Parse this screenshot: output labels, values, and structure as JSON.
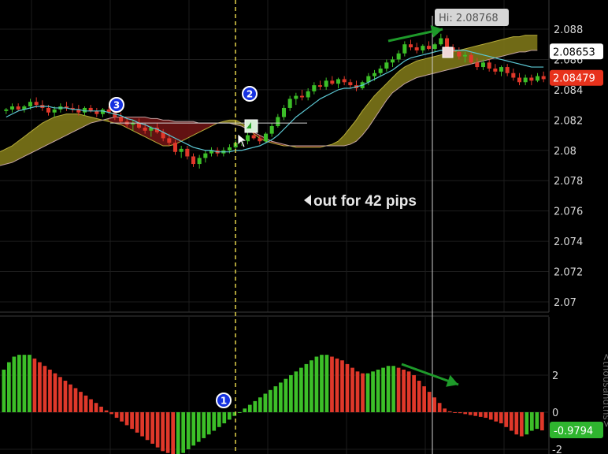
{
  "chart_data": [
    {
      "type": "candlestick",
      "title": "",
      "ylim": [
        2.069,
        2.09
      ],
      "y_ticks": [
        "2.088",
        "2.086",
        "2.084",
        "2.082",
        "2.08",
        "2.078",
        "2.076",
        "2.074",
        "2.072",
        "2.07"
      ],
      "y_tick_values": [
        2.088,
        2.086,
        2.084,
        2.082,
        2.08,
        2.078,
        2.076,
        2.074,
        2.072,
        2.07
      ],
      "price_labels": [
        {
          "text": "2.08653",
          "value": 2.08653,
          "bg": "#ffffff",
          "color": "#000000"
        },
        {
          "text": "2.08479",
          "value": 2.08479,
          "bg": "#e8321c",
          "color": "#ffffff"
        }
      ],
      "high_label": {
        "text": "Hi: 2.08768",
        "value": 2.08768
      },
      "annotation": "out for 42 pips",
      "markers": [
        {
          "label": "3",
          "value": 2.0832
        },
        {
          "label": "2",
          "value": 2.0843
        }
      ],
      "candles": [
        [
          2.0826,
          2.0828,
          2.0824,
          2.0827
        ],
        [
          2.0827,
          2.0831,
          2.0825,
          2.0829
        ],
        [
          2.0829,
          2.0831,
          2.0826,
          2.0827
        ],
        [
          2.0827,
          2.083,
          2.0825,
          2.0829
        ],
        [
          2.0829,
          2.0834,
          2.0827,
          2.0832
        ],
        [
          2.0832,
          2.0835,
          2.0828,
          2.083
        ],
        [
          2.083,
          2.0833,
          2.0826,
          2.0828
        ],
        [
          2.0828,
          2.083,
          2.0823,
          2.0825
        ],
        [
          2.0825,
          2.0829,
          2.0822,
          2.0827
        ],
        [
          2.0827,
          2.0831,
          2.0825,
          2.0829
        ],
        [
          2.0829,
          2.0832,
          2.0826,
          2.0828
        ],
        [
          2.0828,
          2.0831,
          2.0825,
          2.0827
        ],
        [
          2.0827,
          2.083,
          2.0823,
          2.0825
        ],
        [
          2.0825,
          2.0829,
          2.0823,
          2.0828
        ],
        [
          2.0828,
          2.083,
          2.0825,
          2.0826
        ],
        [
          2.0826,
          2.0828,
          2.0822,
          2.0824
        ],
        [
          2.0824,
          2.0828,
          2.0822,
          2.0827
        ],
        [
          2.0827,
          2.0829,
          2.0824,
          2.0825
        ],
        [
          2.0825,
          2.0827,
          2.082,
          2.0822
        ],
        [
          2.0822,
          2.0825,
          2.0818,
          2.0819
        ],
        [
          2.0819,
          2.0822,
          2.0815,
          2.0817
        ],
        [
          2.0817,
          2.082,
          2.0813,
          2.0818
        ],
        [
          2.0818,
          2.0821,
          2.0814,
          2.0815
        ],
        [
          2.0815,
          2.0818,
          2.0811,
          2.0813
        ],
        [
          2.0813,
          2.0816,
          2.0809,
          2.0815
        ],
        [
          2.0815,
          2.0818,
          2.0811,
          2.0812
        ],
        [
          2.0812,
          2.0814,
          2.0806,
          2.0808
        ],
        [
          2.0808,
          2.0811,
          2.0803,
          2.0805
        ],
        [
          2.0805,
          2.0807,
          2.0797,
          2.0799
        ],
        [
          2.0799,
          2.0803,
          2.0795,
          2.0801
        ],
        [
          2.0801,
          2.0803,
          2.0794,
          2.0796
        ],
        [
          2.0796,
          2.0798,
          2.0789,
          2.0791
        ],
        [
          2.0791,
          2.0797,
          2.0788,
          2.0795
        ],
        [
          2.0795,
          2.08,
          2.0792,
          2.0798
        ],
        [
          2.0798,
          2.0802,
          2.0796,
          2.08
        ],
        [
          2.08,
          2.0802,
          2.0796,
          2.0798
        ],
        [
          2.0798,
          2.0802,
          2.0796,
          2.08
        ],
        [
          2.08,
          2.0804,
          2.0798,
          2.0802
        ],
        [
          2.0802,
          2.0807,
          2.08,
          2.0805
        ],
        [
          2.0805,
          2.0809,
          2.0803,
          2.0806
        ],
        [
          2.0806,
          2.0812,
          2.0804,
          2.081
        ],
        [
          2.081,
          2.0813,
          2.0807,
          2.0808
        ],
        [
          2.0808,
          2.081,
          2.0804,
          2.0806
        ],
        [
          2.0806,
          2.0812,
          2.0805,
          2.0811
        ],
        [
          2.0811,
          2.0818,
          2.0809,
          2.0816
        ],
        [
          2.0816,
          2.0824,
          2.0815,
          2.0822
        ],
        [
          2.0822,
          2.083,
          2.082,
          2.0828
        ],
        [
          2.0828,
          2.0836,
          2.0826,
          2.0834
        ],
        [
          2.0834,
          2.0838,
          2.083,
          2.0836
        ],
        [
          2.0836,
          2.084,
          2.0833,
          2.0835
        ],
        [
          2.0835,
          2.0841,
          2.0833,
          2.0839
        ],
        [
          2.0839,
          2.0845,
          2.0837,
          2.0843
        ],
        [
          2.0843,
          2.0846,
          2.084,
          2.0842
        ],
        [
          2.0842,
          2.0848,
          2.084,
          2.0846
        ],
        [
          2.0846,
          2.0849,
          2.0843,
          2.0844
        ],
        [
          2.0844,
          2.0848,
          2.0841,
          2.0847
        ],
        [
          2.0847,
          2.0849,
          2.0843,
          2.0845
        ],
        [
          2.0845,
          2.0847,
          2.0841,
          2.0843
        ],
        [
          2.0843,
          2.0846,
          2.0839,
          2.0841
        ],
        [
          2.0841,
          2.0846,
          2.084,
          2.0845
        ],
        [
          2.0845,
          2.0851,
          2.0843,
          2.0849
        ],
        [
          2.0849,
          2.0853,
          2.0846,
          2.0851
        ],
        [
          2.0851,
          2.0856,
          2.0849,
          2.0854
        ],
        [
          2.0854,
          2.086,
          2.0852,
          2.0858
        ],
        [
          2.0858,
          2.0862,
          2.0855,
          2.086
        ],
        [
          2.086,
          2.0866,
          2.0858,
          2.0864
        ],
        [
          2.0864,
          2.0872,
          2.0862,
          2.087
        ],
        [
          2.087,
          2.0873,
          2.0866,
          2.0868
        ],
        [
          2.0868,
          2.0871,
          2.0864,
          2.0866
        ],
        [
          2.0866,
          2.087,
          2.0864,
          2.0869
        ],
        [
          2.0869,
          2.0872,
          2.0866,
          2.0867
        ],
        [
          2.0867,
          2.0871,
          2.0865,
          2.087
        ],
        [
          2.087,
          2.0877,
          2.0869,
          2.0874
        ],
        [
          2.0874,
          2.0876,
          2.0866,
          2.0868
        ],
        [
          2.0868,
          2.087,
          2.0863,
          2.0865
        ],
        [
          2.0865,
          2.0868,
          2.086,
          2.0862
        ],
        [
          2.0862,
          2.0865,
          2.0858,
          2.0863
        ],
        [
          2.0863,
          2.0865,
          2.0857,
          2.0858
        ],
        [
          2.0858,
          2.0861,
          2.0853,
          2.0855
        ],
        [
          2.0855,
          2.086,
          2.0853,
          2.0858
        ],
        [
          2.0858,
          2.086,
          2.0852,
          2.0854
        ],
        [
          2.0854,
          2.0857,
          2.085,
          2.0852
        ],
        [
          2.0852,
          2.0856,
          2.0849,
          2.0855
        ],
        [
          2.0855,
          2.0857,
          2.0849,
          2.0851
        ],
        [
          2.0851,
          2.0854,
          2.0846,
          2.0848
        ],
        [
          2.0848,
          2.0851,
          2.0843,
          2.0845
        ],
        [
          2.0845,
          2.085,
          2.0843,
          2.0848
        ],
        [
          2.0848,
          2.085,
          2.0843,
          2.0846
        ],
        [
          2.0846,
          2.0851,
          2.0845,
          2.0849
        ],
        [
          2.0849,
          2.0852,
          2.0845,
          2.0847
        ]
      ],
      "tenkan": [
        2.0822,
        2.0824,
        2.0826,
        2.0827,
        2.0828,
        2.0829,
        2.0829,
        2.0829,
        2.0828,
        2.0828,
        2.0828,
        2.0827,
        2.0827,
        2.0826,
        2.0826,
        2.0826,
        2.0826,
        2.0825,
        2.0824,
        2.0823,
        2.0821,
        2.082,
        2.0818,
        2.0817,
        2.0815,
        2.0814,
        2.0812,
        2.081,
        2.0808,
        2.0806,
        2.0804,
        2.0802,
        2.0801,
        2.08,
        2.08,
        2.0799,
        2.0799,
        2.0799,
        2.08,
        2.08,
        2.0801,
        2.0802,
        2.0803,
        2.0805,
        2.0807,
        2.081,
        2.0814,
        2.0818,
        2.0822,
        2.0825,
        2.0828,
        2.0831,
        2.0834,
        2.0836,
        2.0838,
        2.084,
        2.0841,
        2.0841,
        2.0842,
        2.0843,
        2.0845,
        2.0847,
        2.0849,
        2.0851,
        2.0853,
        2.0856,
        2.0859,
        2.0861,
        2.0862,
        2.0863,
        2.0864,
        2.0865,
        2.0866,
        2.0866,
        2.0866,
        2.0866,
        2.0866,
        2.0865,
        2.0864,
        2.0863,
        2.0862,
        2.0861,
        2.086,
        2.0859,
        2.0858,
        2.0857,
        2.0856,
        2.0855,
        2.0855,
        2.0855
      ],
      "cloud_span_a": [
        2.0799,
        2.0801,
        2.0803,
        2.0806,
        2.0809,
        2.0812,
        2.0815,
        2.0818,
        2.082,
        2.0822,
        2.0823,
        2.0824,
        2.0824,
        2.0824,
        2.0823,
        2.0822,
        2.0821,
        2.082,
        2.0819,
        2.0818,
        2.0817,
        2.0815,
        2.0813,
        2.0811,
        2.0809,
        2.0807,
        2.0805,
        2.0803,
        2.0803,
        2.0804,
        2.0806,
        2.0808,
        2.081,
        2.0812,
        2.0814,
        2.0816,
        2.0818,
        2.0819,
        2.082,
        2.082,
        2.0818,
        2.0815,
        2.0811,
        2.0808,
        2.0806,
        2.0805,
        2.0804,
        2.0803,
        2.0803,
        2.0802,
        2.0802,
        2.0802,
        2.0802,
        2.0802,
        2.0803,
        2.0804,
        2.0806,
        2.081,
        2.0815,
        2.082,
        2.0826,
        2.0831,
        2.0836,
        2.084,
        2.0844,
        2.0848,
        2.0852,
        2.0855,
        2.0857,
        2.0859,
        2.086,
        2.0861,
        2.0862,
        2.0863,
        2.0864,
        2.0865,
        2.0866,
        2.0867,
        2.0868,
        2.0869,
        2.087,
        2.0871,
        2.0872,
        2.0873,
        2.0874,
        2.0875,
        2.0875,
        2.0876,
        2.0876,
        2.0876
      ],
      "cloud_span_b": [
        2.079,
        2.0791,
        2.0792,
        2.0794,
        2.0796,
        2.0798,
        2.08,
        2.0802,
        2.0804,
        2.0806,
        2.0808,
        2.081,
        2.0812,
        2.0814,
        2.0816,
        2.0818,
        2.0819,
        2.082,
        2.0821,
        2.0822,
        2.0822,
        2.0822,
        2.0822,
        2.0822,
        2.0822,
        2.0821,
        2.0821,
        2.082,
        2.082,
        2.0819,
        2.0819,
        2.0819,
        2.0819,
        2.0818,
        2.0818,
        2.0818,
        2.0818,
        2.0818,
        2.0818,
        2.0817,
        2.0816,
        2.0814,
        2.0812,
        2.081,
        2.0808,
        2.0806,
        2.0805,
        2.0804,
        2.0803,
        2.0803,
        2.0803,
        2.0803,
        2.0803,
        2.0803,
        2.0803,
        2.0803,
        2.0803,
        2.0803,
        2.0804,
        2.0806,
        2.081,
        2.0815,
        2.0821,
        2.0827,
        2.0833,
        2.0838,
        2.0841,
        2.0844,
        2.0846,
        2.0848,
        2.0849,
        2.085,
        2.0851,
        2.0852,
        2.0853,
        2.0854,
        2.0855,
        2.0856,
        2.0857,
        2.0858,
        2.0859,
        2.086,
        2.0861,
        2.0862,
        2.0863,
        2.0864,
        2.0865,
        2.0865,
        2.0866,
        2.0866
      ]
    },
    {
      "type": "bar",
      "title": "",
      "ylabel": "<thousandths>",
      "ylim": [
        -2.5,
        4.0
      ],
      "y_ticks": [
        "2",
        "0",
        "-2"
      ],
      "y_tick_values": [
        2,
        0,
        -2
      ],
      "value_label": {
        "text": "-0.9794",
        "value": -0.9794
      },
      "markers": [
        {
          "label": "1",
          "value": 0.7
        }
      ],
      "values": [
        2.3,
        2.7,
        3.0,
        3.1,
        3.1,
        3.1,
        2.9,
        2.7,
        2.5,
        2.3,
        2.1,
        1.9,
        1.7,
        1.5,
        1.3,
        1.1,
        0.9,
        0.7,
        0.5,
        0.3,
        0.1,
        -0.1,
        -0.3,
        -0.5,
        -0.7,
        -0.9,
        -1.1,
        -1.3,
        -1.5,
        -1.7,
        -1.9,
        -2.1,
        -2.2,
        -2.3,
        -2.3,
        -2.2,
        -2.0,
        -1.8,
        -1.6,
        -1.4,
        -1.2,
        -1.0,
        -0.8,
        -0.6,
        -0.4,
        -0.2,
        0.0,
        0.2,
        0.4,
        0.6,
        0.8,
        1.0,
        1.2,
        1.4,
        1.6,
        1.8,
        2.0,
        2.2,
        2.4,
        2.6,
        2.8,
        3.0,
        3.1,
        3.1,
        3.0,
        2.9,
        2.8,
        2.6,
        2.4,
        2.2,
        2.1,
        2.1,
        2.2,
        2.3,
        2.4,
        2.5,
        2.5,
        2.4,
        2.3,
        2.2,
        2.0,
        1.7,
        1.4,
        1.1,
        0.8,
        0.5,
        0.2,
        0.05,
        0.0,
        -0.05,
        -0.1,
        -0.15,
        -0.2,
        -0.25,
        -0.3,
        -0.4,
        -0.5,
        -0.6,
        -0.8,
        -1.0,
        -1.2,
        -1.3,
        -1.2,
        -1.0,
        -0.9,
        -0.98
      ]
    }
  ],
  "colors": {
    "background": "#000000",
    "up": "#3cbf28",
    "down": "#e0382a",
    "tenkan": "#5cc8d4",
    "kumo_bull": "#7a7318",
    "kumo_bear": "#6a1414",
    "arrow": "#1e9a2a",
    "marker_fill": "#1531e0",
    "crosshair": "#cfcfcf",
    "vline": "#e2d14a"
  },
  "icons": {
    "arrow_left": "triangle-left-icon",
    "markers": "numbered-circle-icon",
    "cursor": "mouse-pointer-icon"
  }
}
